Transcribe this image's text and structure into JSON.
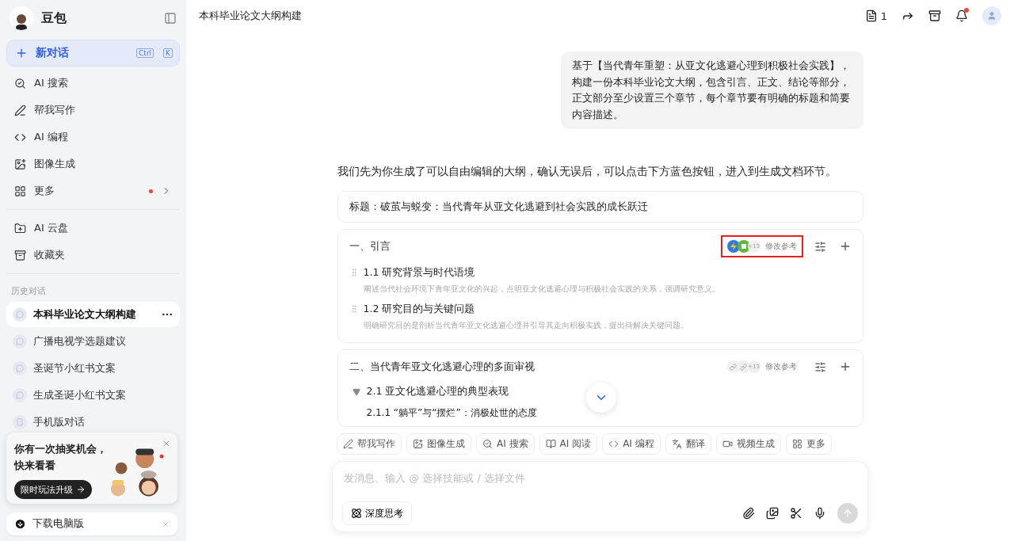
{
  "sidebar": {
    "brand": "豆包",
    "new_chat": {
      "label": "新对话",
      "keys": [
        "Ctrl",
        "K"
      ]
    },
    "nav": [
      {
        "label": "AI 搜索",
        "kind": "link",
        "dot": false
      },
      {
        "label": "帮我写作",
        "kind": "link",
        "dot": false
      },
      {
        "label": "AI 编程",
        "kind": "link",
        "dot": false
      },
      {
        "label": "图像生成",
        "kind": "link",
        "dot": false
      },
      {
        "label": "更多",
        "kind": "menu",
        "dot": true
      }
    ],
    "tools": [
      "AI 云盘",
      "收藏夹"
    ],
    "history_title": "历史对话",
    "history": [
      {
        "label": "本科毕业论文大纲构建",
        "kind": "chat",
        "selected": true
      },
      {
        "label": "广播电视学选题建议",
        "kind": "chat",
        "selected": false
      },
      {
        "label": "圣诞节小红书文案",
        "kind": "chat",
        "selected": false
      },
      {
        "label": "生成圣诞小红书文案",
        "kind": "chat",
        "selected": false
      },
      {
        "label": "手机版对话",
        "kind": "mobile",
        "selected": false
      }
    ],
    "promo": {
      "lines": [
        "你有一次抽奖机会，",
        "快来看看"
      ],
      "button": "限时玩法升级"
    },
    "download": {
      "label": "下载电脑版"
    }
  },
  "header": {
    "title": "本科毕业论文大纲构建",
    "doc_count": "1",
    "notification": true
  },
  "user_message": "基于【当代青年重塑：从亚文化逃避心理到积极社会实践】，构建一份本科毕业论文大纲，包含引言、正文、结论等部分，正文部分至少设置三个章节，每个章节要有明确的标题和简要内容描述。",
  "reply": {
    "intro": "我们先为你生成了可以自由编辑的大纲，确认无误后，可以点击下方蓝色按钮，进入到生成文档环节。",
    "title_card": "标题：破茧与蜕变：当代青年从亚文化逃避到社会实践的成长跃迁",
    "sections": [
      {
        "heading": "一、引言",
        "highlighted": true,
        "ref_count": "+13",
        "ref_label": "修改参考",
        "items": [
          {
            "kind": "point",
            "title": "1.1 研究背景与时代语境",
            "desc": "阐述当代社会环境下青年亚文化的兴起，点明亚文化逃避心理与积极社会实践的关系，强调研究意义。"
          },
          {
            "kind": "point",
            "title": "1.2 研究目的与关键问题",
            "desc": "明确研究目的是剖析当代青年亚文化逃避心理并引导其走向积极实践，提出待解决关键问题。"
          }
        ]
      },
      {
        "heading": "二、当代青年亚文化逃避心理的多面审视",
        "highlighted": false,
        "ref_count": "+13",
        "ref_label": "修改参考",
        "items": [
          {
            "kind": "group",
            "title": "2.1 亚文化逃避心理的典型表现",
            "expanded": true,
            "children": [
              {
                "title": "2.1.1 “躺平”与“摆烂”：消极处世的态度"
              }
            ]
          }
        ]
      }
    ]
  },
  "composer": {
    "actions": [
      "帮我写作",
      "图像生成",
      "AI 搜索",
      "AI 阅读",
      "AI 编程",
      "翻译",
      "视频生成",
      "更多"
    ],
    "placeholder": "发消息、输入 @ 选择技能或 / 选择文件",
    "deep_think": "深度思考",
    "send_disabled": true
  }
}
